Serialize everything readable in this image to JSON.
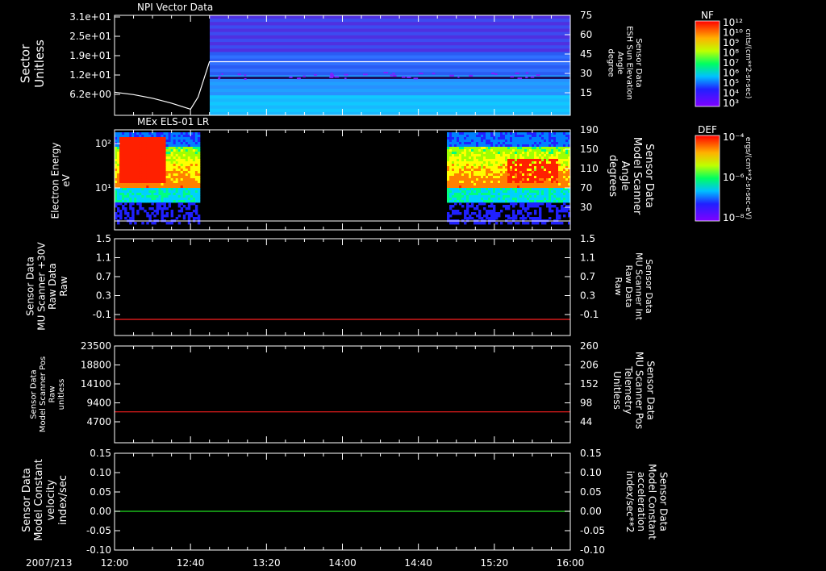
{
  "header": {
    "date": "2007/213"
  },
  "time_axis": {
    "ticks": [
      "12:00",
      "12:40",
      "13:20",
      "14:00",
      "14:40",
      "15:20",
      "16:00"
    ]
  },
  "chart_data": [
    {
      "type": "heatmap",
      "title": "NPI Vector Data",
      "ylabel": "Sector\nUnitless",
      "yticks": [
        "3.1e+01",
        "2.5e+01",
        "1.9e+01",
        "1.2e+01",
        "6.2e+00"
      ],
      "y2label": "Sensor Data\nESH Sun Elevation\nAngle\ndegree",
      "y2ticks": [
        "75",
        "60",
        "45",
        "30",
        "15"
      ],
      "colorbar": {
        "label": "NF",
        "units": "cnts/(cm**2-sr-sec)",
        "ticks": [
          "10¹²",
          "10¹⁰",
          "10⁹",
          "10⁸",
          "10⁷",
          "10⁶",
          "10⁵",
          "10⁴",
          "10³"
        ]
      },
      "line_series": {
        "name": "ESH Sun Elevation Angle",
        "x": [
          "12:00",
          "12:10",
          "12:20",
          "12:30",
          "12:36",
          "12:40",
          "12:44",
          "12:50",
          "13:20",
          "14:00",
          "14:40",
          "15:20",
          "16:00"
        ],
        "y": [
          19,
          17,
          14,
          10,
          7,
          5,
          15,
          44,
          44,
          44,
          44,
          44,
          44
        ]
      }
    },
    {
      "type": "heatmap",
      "title": "MEx ELS-01 LR",
      "ylabel": "Electron Energy\neV",
      "yticks": [
        "10²",
        "10¹"
      ],
      "y2label": "Sensor Data\nModel Scanner\nAngle\ndegrees",
      "y2ticks": [
        "190",
        "150",
        "110",
        "70",
        "30"
      ],
      "colorbar": {
        "label": "DEF",
        "units": "ergs/(cm**2-sr-sec-eV)",
        "ticks": [
          "10⁻⁴",
          "10⁻⁶",
          "10⁻⁸"
        ]
      },
      "data_windows": [
        [
          "12:00",
          "12:45"
        ],
        [
          "14:55",
          "16:00"
        ]
      ]
    },
    {
      "type": "line",
      "ylabel": "Sensor Data\nMU Scanner +30V\nRaw Data\nRaw",
      "yticks": [
        "1.5",
        "1.1",
        "0.7",
        "0.3",
        "-0.1"
      ],
      "ylim": [
        -0.3,
        1.5
      ],
      "y2label": "Sensor Data\nMU Scanner Int\nRaw Data\nRaw",
      "y2ticks": [
        "1.5",
        "1.1",
        "0.7",
        "0.3",
        "-0.1"
      ],
      "series": [
        {
          "name": "MU Scanner Int Raw Data",
          "color": "#ff2020",
          "value": 0
        }
      ]
    },
    {
      "type": "line",
      "ylabel": "Sensor Data\nModel Scanner Pos\nRaw\nunitless",
      "yticks": [
        "23500",
        "18800",
        "14100",
        "9400",
        "4700"
      ],
      "ylim": [
        0,
        23500
      ],
      "y2label": "Sensor Data\nMU Scanner Pos\nTelemetry\nUnitless",
      "y2ticks": [
        "260",
        "206",
        "152",
        "98",
        "44"
      ],
      "series": [
        {
          "name": "MU Scanner Pos Telemetry",
          "color": "#ff2020",
          "value": 7500
        }
      ]
    },
    {
      "type": "line",
      "ylabel": "Sensor Data\nModel Constant\nvelocity\nindex/sec",
      "yticks": [
        "0.15",
        "0.10",
        "0.05",
        "0.00",
        "-0.05",
        "-0.10"
      ],
      "ylim": [
        -0.1,
        0.15
      ],
      "y2label": "Sensor Data\nModel Constant\nacceleration\nindex/sec**2",
      "y2ticks": [
        "0.15",
        "0.10",
        "0.05",
        "0.00",
        "-0.05",
        "-0.10"
      ],
      "series": [
        {
          "name": "Model Constant acceleration",
          "color": "#20e020",
          "value": 0
        }
      ]
    }
  ]
}
